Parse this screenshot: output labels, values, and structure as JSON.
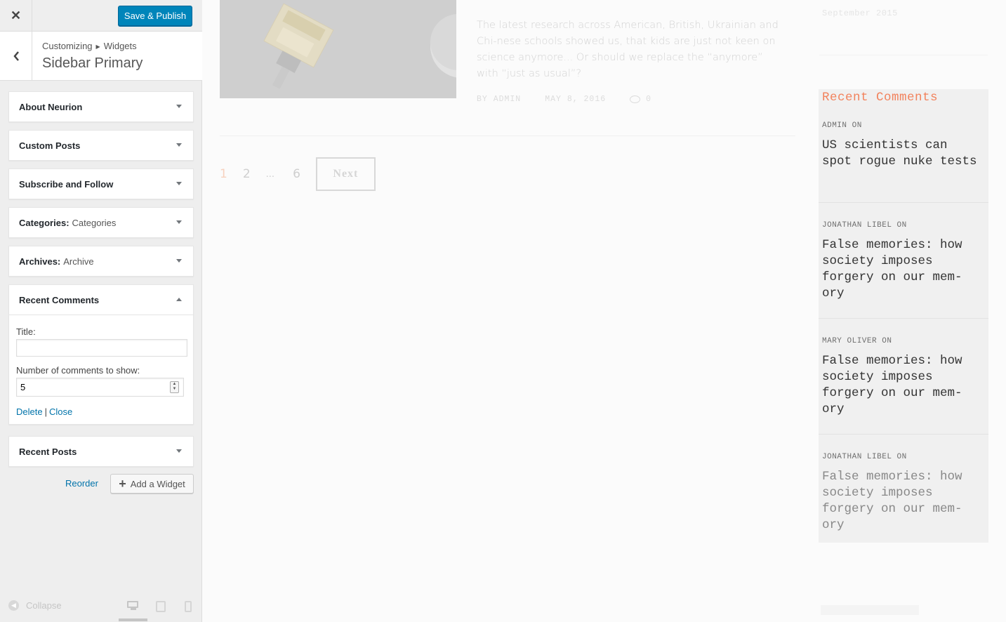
{
  "header": {
    "save_label": "Save & Publish"
  },
  "section": {
    "breadcrumb_root": "Customizing",
    "breadcrumb_leaf": "Widgets",
    "title": "Sidebar Primary"
  },
  "widgets": [
    {
      "title": "About Neurion",
      "sub": ""
    },
    {
      "title": "Custom Posts",
      "sub": ""
    },
    {
      "title": "Subscribe and Follow",
      "sub": ""
    },
    {
      "title": "Categories:",
      "sub": "Categories"
    },
    {
      "title": "Archives:",
      "sub": "Archive"
    },
    {
      "title": "Recent Comments",
      "sub": ""
    },
    {
      "title": "Recent Posts",
      "sub": ""
    }
  ],
  "recent_comments_form": {
    "title_label": "Title:",
    "title_value": "",
    "number_label": "Number of comments to show:",
    "number_value": "5",
    "delete_label": "Delete",
    "pipe": "|",
    "close_label": "Close"
  },
  "footer_actions": {
    "reorder_label": "Reorder",
    "add_widget_label": "Add a Widget",
    "collapse_label": "Collapse"
  },
  "preview": {
    "excerpt": "The latest research across American, British, Ukrainian and Chi-nese schools showed us, that kids are just not keen on science anymore... Or should we replace the “anymore” with “just as usual”?",
    "meta_author": "BY ADMIN",
    "meta_date": "MAY 8, 2016",
    "meta_comments": "0",
    "pager": {
      "current": "1",
      "page2": "2",
      "dots": "...",
      "last": "6",
      "next": "Next"
    },
    "archive_date": "September 2015",
    "recent_comments": {
      "title": "Recent Comments",
      "items": [
        {
          "author": "ADMIN ON",
          "link": "US scientists can spot rogue nuke tests"
        },
        {
          "author": "JONATHAN LIBEL ON",
          "link": "False memories: how society imposes forgery on our mem-ory"
        },
        {
          "author": "MARY OLIVER ON",
          "link": "False memories: how society imposes forgery on our mem-ory"
        },
        {
          "author": "JONATHAN LIBEL ON",
          "link": "False memories: how society imposes forgery on our mem-ory"
        }
      ]
    }
  },
  "colors": {
    "primary_button": "#0085ba",
    "link": "#0073aa",
    "accent_orange": "#f2825c"
  }
}
